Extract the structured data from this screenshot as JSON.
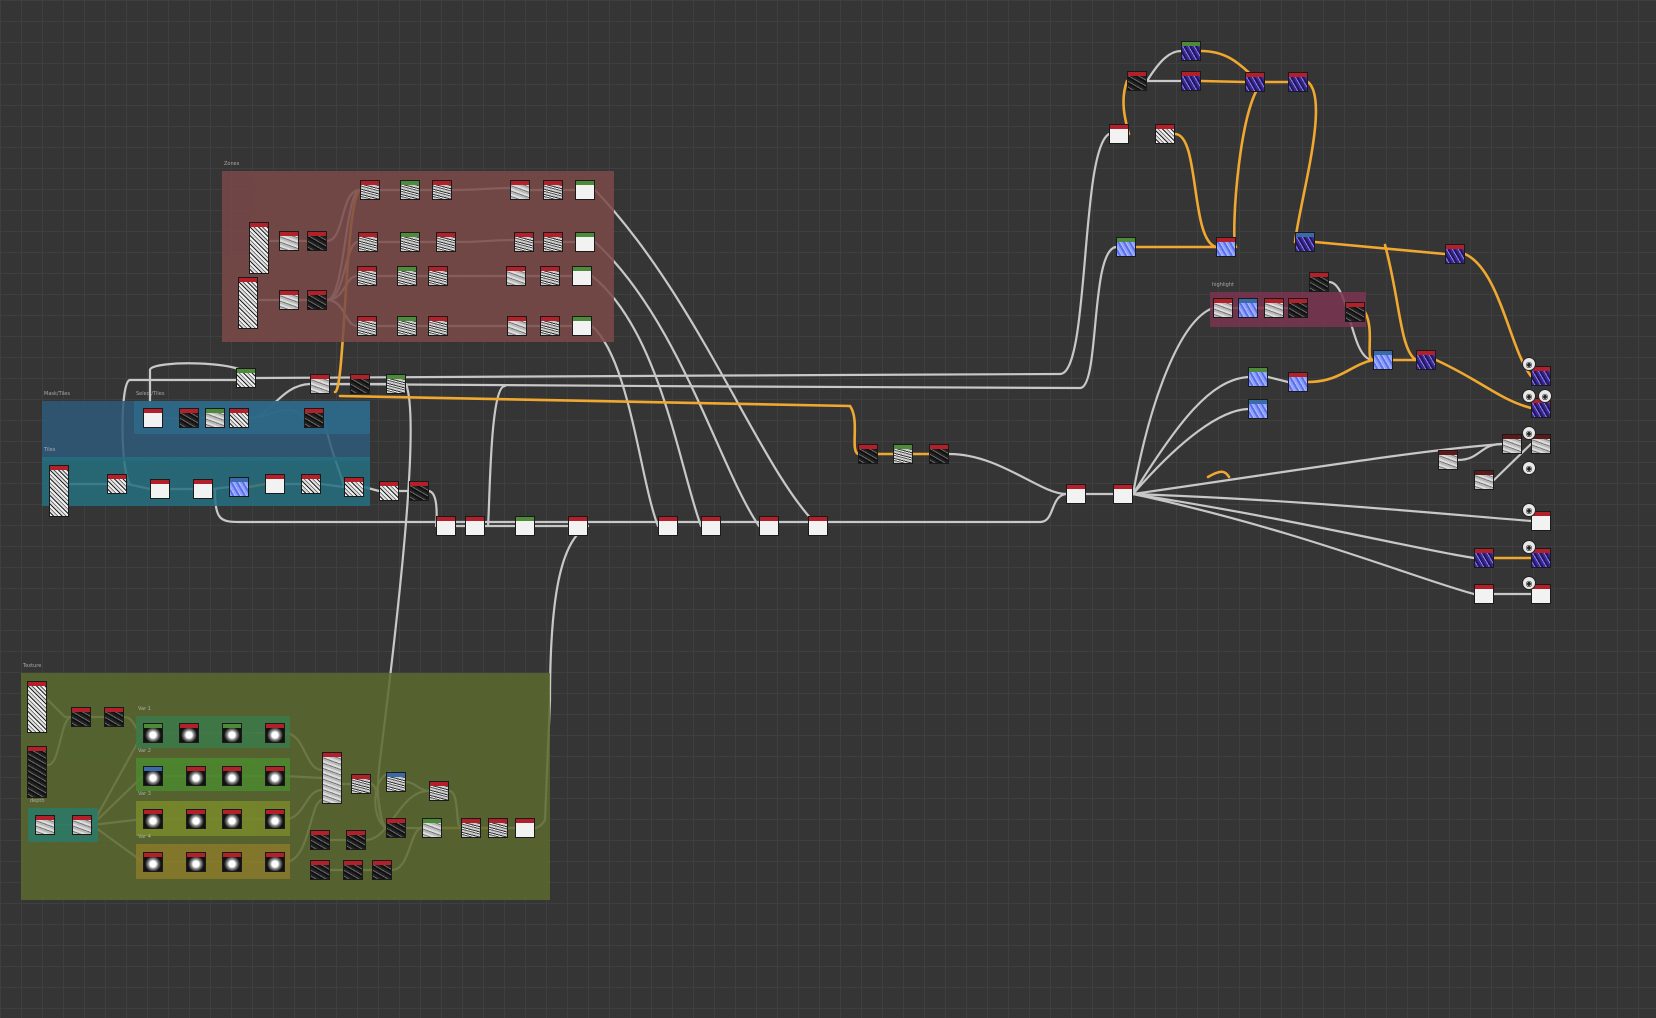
{
  "frames": [
    {
      "title": "Zones",
      "color": "#7a4a48"
    },
    {
      "title": "Mask/Tiles",
      "color": "#2e5a7a"
    },
    {
      "title": "Select/Tiles",
      "color": "#2e6a8a"
    },
    {
      "title": "Tiles",
      "color": "#257080"
    },
    {
      "title": "Texture",
      "color": "#5a6a2e"
    },
    {
      "title": "Var 1",
      "color": "#3c7a4a"
    },
    {
      "title": "Var 2",
      "color": "#4c8a2e"
    },
    {
      "title": "Var 3",
      "color": "#7a8a2a"
    },
    {
      "title": "Var 4",
      "color": "#8a7a2a"
    },
    {
      "title": "depth",
      "color": "#2a7a6a"
    },
    {
      "title": "highlight",
      "color": "#7a3450"
    }
  ],
  "colors": {
    "background": "#353535",
    "wire_default": "#c8c8c8",
    "wire_highlight": "#f0a830",
    "header_red": "#b3202a",
    "header_green": "#4d8a3a",
    "header_blue": "#3a6aa8",
    "header_dark": "#5a1a1a"
  },
  "textures": {
    "noise": "noise",
    "white": "white",
    "dark": "dark",
    "blue": "blue",
    "gray": "gray",
    "sphere": "sphere",
    "purple": "purple",
    "stone": "stone"
  }
}
